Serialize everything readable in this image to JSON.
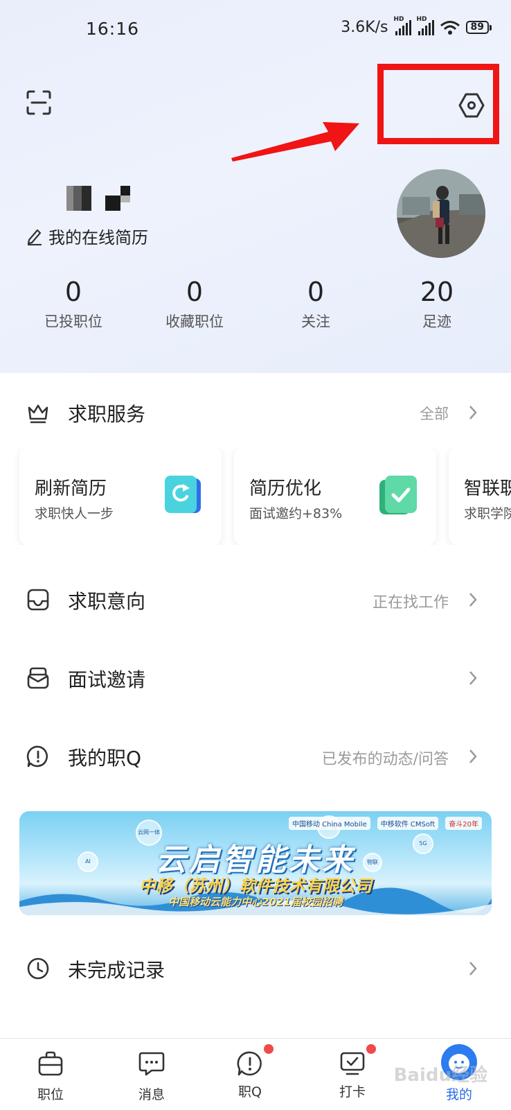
{
  "status_bar": {
    "time": "16:16",
    "net_speed": "3.6K/s",
    "hd1": "HD",
    "hd2": "HD",
    "battery": "89"
  },
  "profile": {
    "edit_resume_label": "我的在线简历"
  },
  "stats": [
    {
      "value": "0",
      "label": "已投职位"
    },
    {
      "value": "0",
      "label": "收藏职位"
    },
    {
      "value": "0",
      "label": "关注"
    },
    {
      "value": "20",
      "label": "足迹"
    }
  ],
  "job_service": {
    "title": "求职服务",
    "all_label": "全部",
    "cards": [
      {
        "title": "刷新简历",
        "subtitle": "求职快人一步",
        "icon": "refresh-resume-icon"
      },
      {
        "title": "简历优化",
        "subtitle": "面试邀约+83%",
        "icon": "resume-optimize-icon"
      },
      {
        "title": "智联职",
        "subtitle": "求职学院",
        "icon": "career-icon"
      }
    ]
  },
  "menu": {
    "intent": {
      "title": "求职意向",
      "status": "正在找工作"
    },
    "interview": {
      "title": "面试邀请"
    },
    "zhiq": {
      "title": "我的职Q",
      "status": "已发布的动态/问答"
    },
    "unfinished": {
      "title": "未完成记录"
    }
  },
  "banner": {
    "headline": "云启智能未来",
    "company": "中移（苏州）软件技术有限公司",
    "subline": "中国移动云能力中心2021届校园招聘",
    "brand1": "中国移动 China Mobile",
    "brand2": "中移软件 CMSoft",
    "brand3": "奋斗20年",
    "bubble1": "云网一体",
    "bubble2": "AI",
    "bubble3": "云计算",
    "bubble4": "5G",
    "bubble5": "物联"
  },
  "tabbar": {
    "jobs": "职位",
    "messages": "消息",
    "zhiq": "职Q",
    "checkin": "打卡",
    "me": "我的"
  },
  "watermark": "Baidu经验",
  "colors": {
    "accent": "#2a6ce6",
    "highlight": "#f01414",
    "badge": "#f04a4a"
  }
}
